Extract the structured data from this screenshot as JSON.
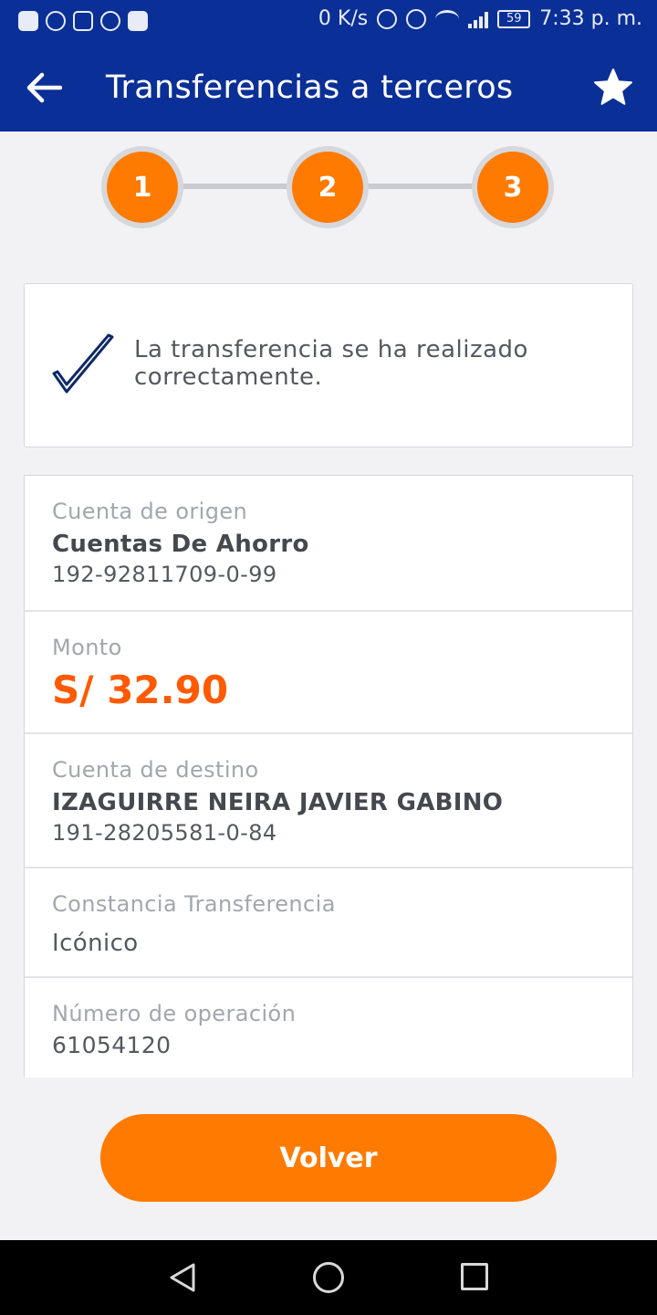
{
  "status_bar": {
    "net_speed": "0 K/s",
    "battery": "59",
    "time": "7:33 p. m.",
    "icons": [
      "shield-icon",
      "whatsapp-icon",
      "gmail-icon",
      "instagram-icon",
      "trello-icon",
      "alarm-icon",
      "eye-icon",
      "wifi-icon",
      "signal-icon",
      "battery-icon"
    ]
  },
  "header": {
    "title": "Transferencias a terceros",
    "back_icon": "arrow-left-icon",
    "favorite_icon": "star-icon"
  },
  "stepper": {
    "steps": [
      "1",
      "2",
      "3"
    ],
    "active_color": "#ff7a00"
  },
  "success": {
    "icon": "checkmark-icon",
    "message": "La transferencia se ha realizado correctamente."
  },
  "details": {
    "origin": {
      "label": "Cuenta de origen",
      "account_type": "Cuentas De Ahorro",
      "account_number": "192-92811709-0-99"
    },
    "amount": {
      "label": "Monto",
      "value": "S/ 32.90"
    },
    "destination": {
      "label": "Cuenta de destino",
      "name": "IZAGUIRRE NEIRA JAVIER GABINO",
      "account_number": "191-28205581-0-84"
    },
    "receipt": {
      "label": "Constancia Transferencia",
      "value": "Icónico"
    },
    "operation": {
      "label": "Número de operación",
      "value": "61054120"
    }
  },
  "actions": {
    "back_button": "Volver"
  },
  "colors": {
    "brand_blue": "#0a2f96",
    "accent_orange": "#ff7a00",
    "amount_orange": "#ff5a00"
  }
}
